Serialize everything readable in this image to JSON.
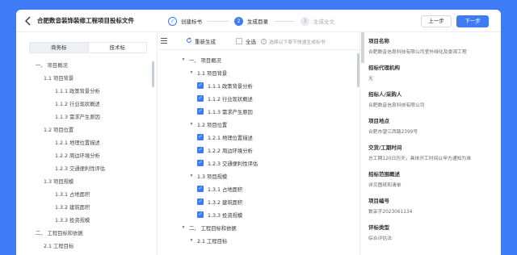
{
  "header": {
    "back_icon": "chevron-left-icon",
    "title": "合肥数音装饰装修工程项目投标文件",
    "steps": [
      {
        "label": "创建标书",
        "num": "✓",
        "state": "done"
      },
      {
        "label": "生成目录",
        "num": "2",
        "state": "active"
      },
      {
        "label": "生成全文",
        "num": "3",
        "state": "todo"
      }
    ],
    "prev_label": "上一步",
    "next_label": "下一步"
  },
  "left": {
    "tabs": [
      "商务标",
      "技术标"
    ],
    "outline": [
      {
        "text": "一、 项目概况",
        "level": 0
      },
      {
        "text": "1.1 项目背景",
        "level": 1
      },
      {
        "text": "1.1.1 政策背景分析",
        "level": 2
      },
      {
        "text": "1.1.2 行业现状概述",
        "level": 2
      },
      {
        "text": "1.1.3 需求产生原因",
        "level": 2
      },
      {
        "text": "1.2 项目位置",
        "level": 1
      },
      {
        "text": "1.2.1 地理位置描述",
        "level": 2
      },
      {
        "text": "1.2.2 周边环境分析",
        "level": 2
      },
      {
        "text": "1.2.3 交通便利性评估",
        "level": 2
      },
      {
        "text": "1.3 项目规模",
        "level": 1
      },
      {
        "text": "1.3.1 占地面积",
        "level": 2
      },
      {
        "text": "1.3.2 建筑面积",
        "level": 2
      },
      {
        "text": "1.3.3 投资规模",
        "level": 2
      },
      {
        "text": "二、 工程目标和依据",
        "level": 0
      },
      {
        "text": "2.1 工程目标",
        "level": 1
      }
    ]
  },
  "middle": {
    "regenerate_label": "重新生成",
    "select_all_label": "全选",
    "hint": "选择以下章节快速生成标书",
    "tree": [
      {
        "text": "一、 项目概况",
        "level": 0,
        "caret": "▾",
        "checked": false
      },
      {
        "text": "1.1 项目背景",
        "level": 1,
        "caret": "▾",
        "checked": false
      },
      {
        "text": "1.1.1 政策背景分析",
        "level": 2,
        "caret": "",
        "checked": true
      },
      {
        "text": "1.1.2 行业现状概述",
        "level": 2,
        "caret": "",
        "checked": true
      },
      {
        "text": "1.1.3 需求产生原因",
        "level": 2,
        "caret": "",
        "checked": true
      },
      {
        "text": "1.2 项目位置",
        "level": 1,
        "caret": "▾",
        "checked": false
      },
      {
        "text": "1.2.1 地理位置描述",
        "level": 2,
        "caret": "",
        "checked": true
      },
      {
        "text": "1.2.2 周边环境分析",
        "level": 2,
        "caret": "",
        "checked": true
      },
      {
        "text": "1.2.3 交通便利性评估",
        "level": 2,
        "caret": "",
        "checked": true
      },
      {
        "text": "1.3 项目规模",
        "level": 1,
        "caret": "▾",
        "checked": false
      },
      {
        "text": "1.3.1 占地面积",
        "level": 2,
        "caret": "",
        "checked": true
      },
      {
        "text": "1.3.2 建筑面积",
        "level": 2,
        "caret": "",
        "checked": true
      },
      {
        "text": "1.3.3 投资规模",
        "level": 2,
        "caret": "",
        "checked": true
      },
      {
        "text": "二、 工程目标和依据",
        "level": 0,
        "caret": "▾",
        "checked": false
      },
      {
        "text": "2.1 工程目标",
        "level": 1,
        "caret": "▾",
        "checked": false
      }
    ]
  },
  "right": {
    "fields": [
      {
        "label": "项目名称",
        "value": "合肥数音信息科技有限公司室外绿化及景观工程"
      },
      {
        "label": "招标代理机构",
        "value": "无"
      },
      {
        "label": "招标人/采购人",
        "value": "合肥数音信息科技有限公司"
      },
      {
        "label": "项目地点",
        "value": "合肥市望江西路2399号"
      },
      {
        "label": "交货/工期时间",
        "value": "总工期120日历天，具体开工时间以甲方通知为准"
      },
      {
        "label": "招标范围概述",
        "value": "详见图纸和清单"
      },
      {
        "label": "项目编号",
        "value": "数采字2023061134"
      },
      {
        "label": "评标类型",
        "value": "综合评估法"
      }
    ]
  },
  "colors": {
    "accent": "#3d7cf6",
    "background": "#3d7cf6"
  }
}
